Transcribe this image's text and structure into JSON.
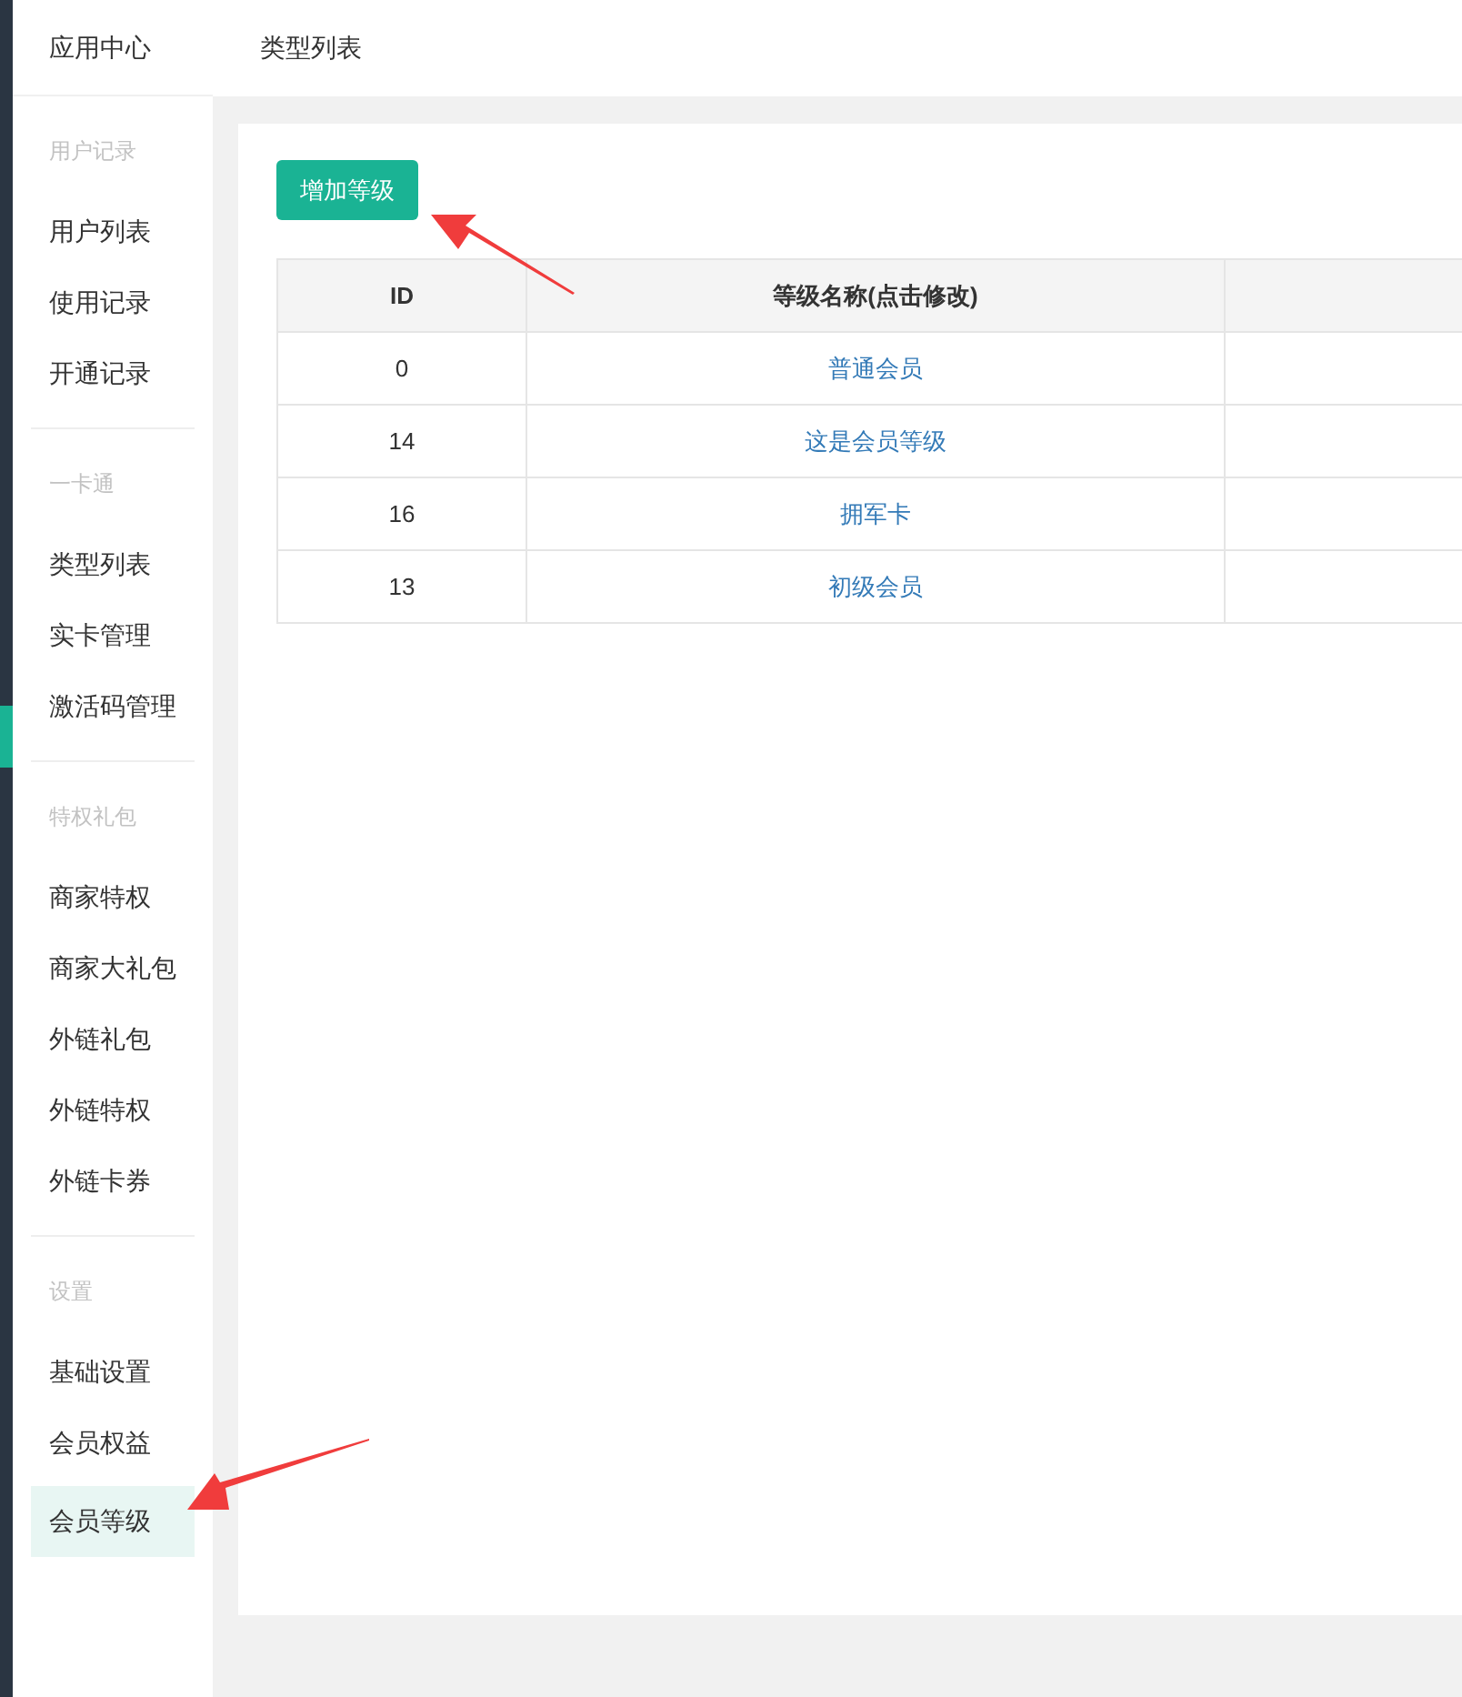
{
  "sidebar": {
    "title": "应用中心",
    "groups": [
      {
        "heading": "用户记录",
        "items": [
          {
            "label": "用户列表",
            "selected": false
          },
          {
            "label": "使用记录",
            "selected": false
          },
          {
            "label": "开通记录",
            "selected": false
          }
        ]
      },
      {
        "heading": "一卡通",
        "items": [
          {
            "label": "类型列表",
            "selected": false
          },
          {
            "label": "实卡管理",
            "selected": false
          },
          {
            "label": "激活码管理",
            "selected": false
          }
        ]
      },
      {
        "heading": "特权礼包",
        "items": [
          {
            "label": "商家特权",
            "selected": false
          },
          {
            "label": "商家大礼包",
            "selected": false
          },
          {
            "label": "外链礼包",
            "selected": false
          },
          {
            "label": "外链特权",
            "selected": false
          },
          {
            "label": "外链卡券",
            "selected": false
          }
        ]
      },
      {
        "heading": "设置",
        "items": [
          {
            "label": "基础设置",
            "selected": false
          },
          {
            "label": "会员权益",
            "selected": false
          },
          {
            "label": "会员等级",
            "selected": true
          }
        ]
      }
    ]
  },
  "header": {
    "title": "类型列表"
  },
  "add_button": "增加等级",
  "table": {
    "columns": [
      "ID",
      "等级名称(点击修改)"
    ],
    "rows": [
      {
        "id": "0",
        "name": "普通会员"
      },
      {
        "id": "14",
        "name": "这是会员等级"
      },
      {
        "id": "16",
        "name": "拥军卡"
      },
      {
        "id": "13",
        "name": "初级会员"
      }
    ]
  }
}
